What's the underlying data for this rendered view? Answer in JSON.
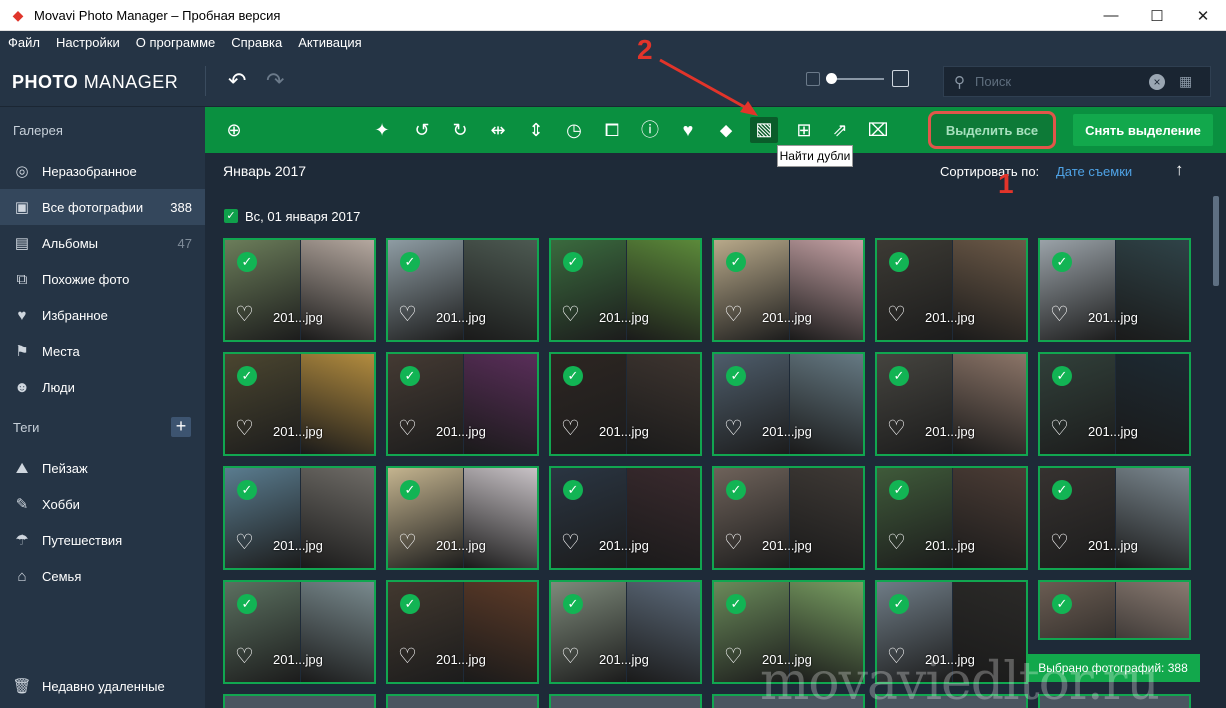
{
  "window": {
    "title": "Movavi Photo Manager – Пробная версия"
  },
  "menu": [
    "Файл",
    "Настройки",
    "О программе",
    "Справка",
    "Активация"
  ],
  "header": {
    "logo_bold": "PHOTO",
    "logo_rest": " MANAGER",
    "search_placeholder": "Поиск"
  },
  "sidebar": {
    "gallery_label": "Галерея",
    "items": [
      {
        "label": "Неразобранное",
        "icon": "camera-icon",
        "count": ""
      },
      {
        "label": "Все фотографии",
        "icon": "photos-icon",
        "count": "388"
      },
      {
        "label": "Альбомы",
        "icon": "albums-icon",
        "count": "47"
      },
      {
        "label": "Похожие фото",
        "icon": "similar-icon",
        "count": ""
      },
      {
        "label": "Избранное",
        "icon": "heart-icon",
        "count": ""
      },
      {
        "label": "Места",
        "icon": "pin-icon",
        "count": ""
      },
      {
        "label": "Люди",
        "icon": "person-icon",
        "count": ""
      }
    ],
    "tags_label": "Теги",
    "tags": [
      {
        "label": "Пейзаж",
        "icon": "landscape-icon"
      },
      {
        "label": "Хобби",
        "icon": "hobby-icon"
      },
      {
        "label": "Путешествия",
        "icon": "palm-icon"
      },
      {
        "label": "Семья",
        "icon": "home-icon"
      }
    ],
    "trash_label": "Недавно удаленные"
  },
  "toolbar": {
    "select_all": "Выделить все",
    "deselect": "Снять выделение",
    "tooltip": "Найти дубли"
  },
  "content": {
    "month": "Январь 2017",
    "sort_label": "Сортировать по:",
    "sort_value": "Дате съемки",
    "day_label": "Вс, 01 января 2017",
    "file_label": "201...jpg"
  },
  "status": {
    "selected": "Выбрано фотографий: 388"
  },
  "annotations": {
    "one": "1",
    "two": "2"
  },
  "watermark": "movaviedltor.ru",
  "colors": {
    "toolbar_green": "#0a9040",
    "accent_red": "#e2564a",
    "link_blue": "#4fa3e6",
    "sidebar_bg": "#253445"
  }
}
